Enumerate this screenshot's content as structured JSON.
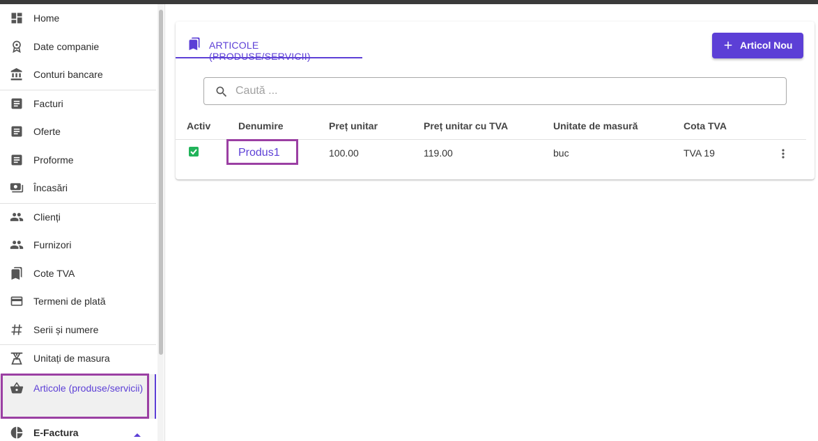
{
  "sidebar": {
    "items": [
      {
        "label": "Home",
        "icon": "dashboard-icon"
      },
      {
        "label": "Date companie",
        "icon": "badge-icon"
      },
      {
        "label": "Conturi bancare",
        "icon": "bank-icon"
      },
      {
        "label": "Facturi",
        "icon": "document-icon"
      },
      {
        "label": "Oferte",
        "icon": "document-icon"
      },
      {
        "label": "Proforme",
        "icon": "document-icon"
      },
      {
        "label": "Încasări",
        "icon": "cash-icon"
      },
      {
        "label": "Clienți",
        "icon": "people-icon"
      },
      {
        "label": "Furnizori",
        "icon": "people-icon"
      },
      {
        "label": "Cote TVA",
        "icon": "bookmarks-icon"
      },
      {
        "label": "Termeni de plată",
        "icon": "credit-card-icon"
      },
      {
        "label": "Serii și numere",
        "icon": "hashtag-icon"
      },
      {
        "label": "Unitați de masura",
        "icon": "scale-icon"
      },
      {
        "label": "Articole (produse/servicii)",
        "icon": "basket-icon"
      },
      {
        "label": "E-Factura",
        "icon": "pie-chart-icon"
      }
    ]
  },
  "page": {
    "tab_label": "ARTICOLE (PRODUSE/SERVICII)",
    "new_button_label": "Articol Nou",
    "search_placeholder": "Caută ..."
  },
  "table": {
    "headers": [
      "Activ",
      "Denumire",
      "Preț unitar",
      "Preț unitar cu TVA",
      "Unitate de masură",
      "Cota TVA"
    ],
    "rows": [
      {
        "activ": true,
        "denumire": "Produs1",
        "pret": "100.00",
        "pret_tva": "119.00",
        "unitate": "buc",
        "cota": "TVA 19"
      }
    ]
  },
  "colors": {
    "accent": "#5c3fd6",
    "highlight": "#9b3fa3",
    "checkbox": "#21b35a"
  }
}
